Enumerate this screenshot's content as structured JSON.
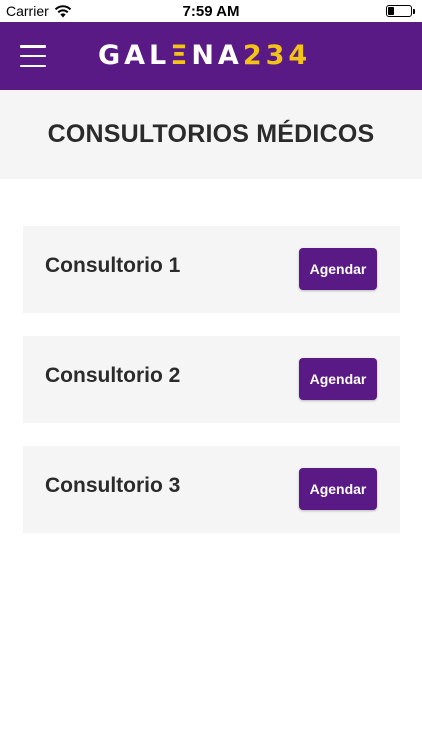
{
  "status_bar": {
    "carrier": "Carrier",
    "time": "7:59 AM",
    "icons": [
      "wifi-icon",
      "battery-icon"
    ]
  },
  "header": {
    "menu_icon": "hamburger-menu-icon",
    "logo": {
      "part_a": "GAL",
      "part_b": "Ξ",
      "part_c": "NA",
      "part_d": "234"
    },
    "colors": {
      "background": "#5a1a86",
      "logo_accent": "#f3c318"
    }
  },
  "page": {
    "title": "CONSULTORIOS MÉDICOS"
  },
  "consultorios": [
    {
      "name": "Consultorio 1",
      "button_label": "Agendar"
    },
    {
      "name": "Consultorio 2",
      "button_label": "Agendar"
    },
    {
      "name": "Consultorio 3",
      "button_label": "Agendar"
    }
  ]
}
